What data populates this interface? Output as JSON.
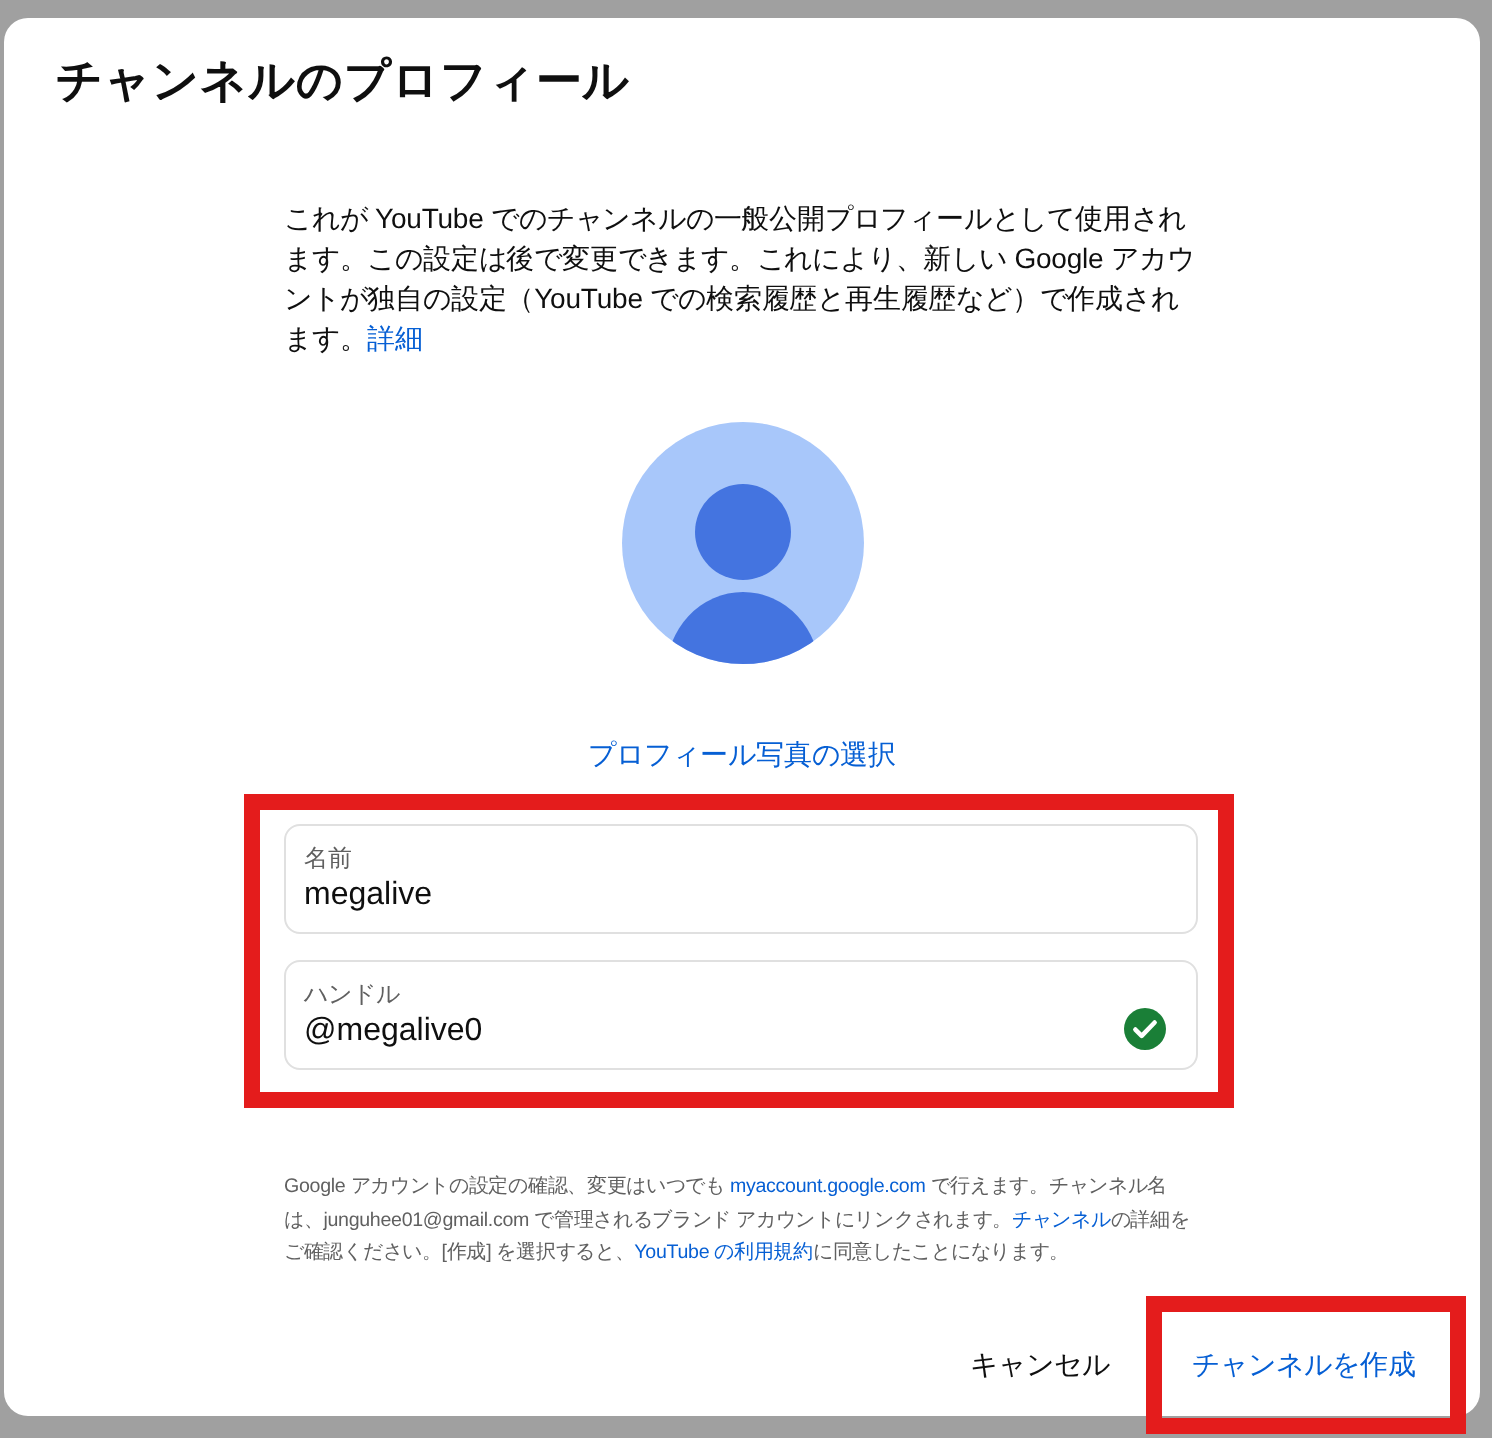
{
  "dialog": {
    "title": "チャンネルのプロフィール",
    "intro": [
      {
        "kind": "text",
        "text": "これが YouTube でのチャンネルの一般公開プロフィールとして使用されます。この設定は後で変更できます。これにより、新しい Google アカウントが独自の設定（YouTube での検索履歴と再生履歴など）で作成されます。"
      },
      {
        "kind": "link",
        "text": "詳細"
      }
    ],
    "photo_link": "プロフィール写真の選択",
    "fields": {
      "highlighted": true,
      "items": [
        {
          "label": "名前",
          "value": "megalive",
          "valid": false
        },
        {
          "label": "ハンドル",
          "value": "@megalive0",
          "valid": true
        }
      ]
    },
    "note": [
      {
        "kind": "text",
        "text": "Google アカウントの設定の確認、変更はいつでも "
      },
      {
        "kind": "link",
        "text": "myaccount.google.com"
      },
      {
        "kind": "text",
        "text": " で行えます。チャンネル名は、junguhee01@gmail.com で管理されるブランド アカウントにリンクされます。"
      },
      {
        "kind": "link",
        "text": "チャンネル"
      },
      {
        "kind": "text",
        "text": "の詳細をご確認ください。[作成] を選択すると、"
      },
      {
        "kind": "link",
        "text": "YouTube の利用規約"
      },
      {
        "kind": "text",
        "text": "に同意したことになります。"
      }
    ],
    "buttons": [
      {
        "kind": "plain",
        "label": "キャンセル",
        "highlighted": false
      },
      {
        "kind": "accent",
        "label": "チャンネルを作成",
        "highlighted": true
      }
    ]
  }
}
